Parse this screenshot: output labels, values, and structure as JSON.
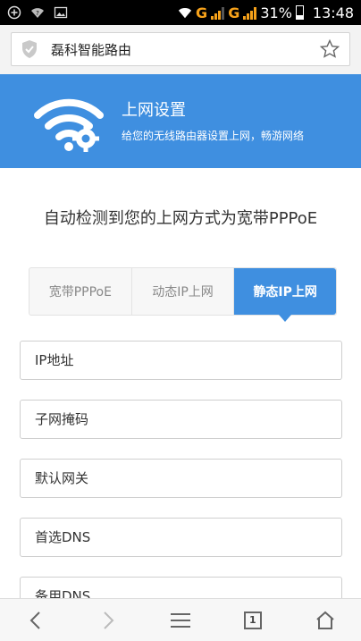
{
  "status_bar": {
    "network_1": "G",
    "network_2": "G",
    "battery_pct": "31%",
    "time": "13:48"
  },
  "browser": {
    "page_title": "磊科智能路由",
    "tab_count": "1"
  },
  "banner": {
    "title": "上网设置",
    "subtitle": "给您的无线路由器设置上网，畅游网络"
  },
  "detect_message": "自动检测到您的上网方式为宽带PPPoE",
  "tabs": [
    {
      "label": "宽带PPPoE",
      "active": false
    },
    {
      "label": "动态IP上网",
      "active": false
    },
    {
      "label": "静态IP上网",
      "active": true
    }
  ],
  "fields": {
    "ip_address": {
      "placeholder": "IP地址"
    },
    "subnet_mask": {
      "placeholder": "子网掩码"
    },
    "default_gateway": {
      "placeholder": "默认网关"
    },
    "primary_dns": {
      "placeholder": "首选DNS"
    },
    "secondary_dns": {
      "placeholder": "备用DNS"
    }
  },
  "colors": {
    "accent": "#3f8fe0",
    "signal": "#f7a21a"
  }
}
